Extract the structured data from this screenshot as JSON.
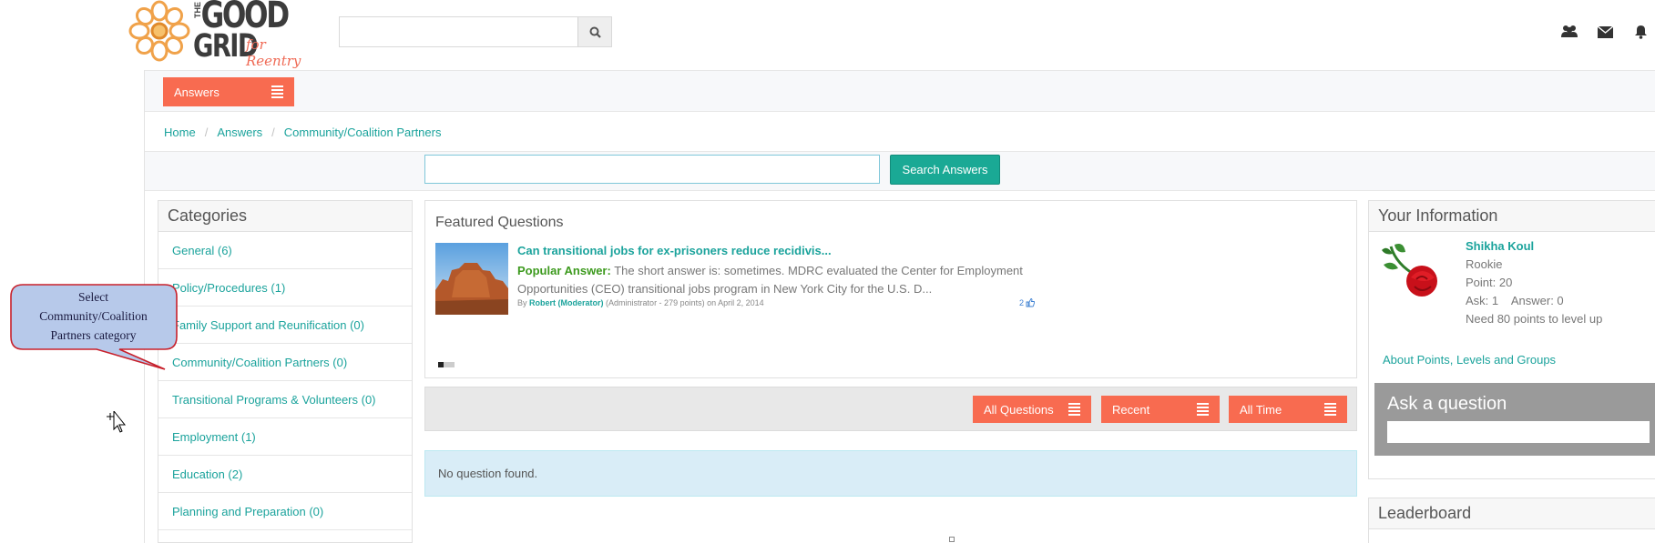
{
  "header": {
    "logo": {
      "the": "THE",
      "good": "GOOD",
      "grid": "GRID",
      "tagline": "for Reentry"
    },
    "search_placeholder": "",
    "icons": [
      "search-icon",
      "users-icon",
      "envelope-icon",
      "bell-icon"
    ]
  },
  "answers_menu": {
    "label": "Answers"
  },
  "breadcrumb": [
    "Home",
    "Answers",
    "Community/Coalition Partners"
  ],
  "answer_search": {
    "value": "",
    "button_label": "Search Answers"
  },
  "categories": {
    "title": "Categories",
    "items": [
      "General (6)",
      "Policy/Procedures (1)",
      "Family Support and Reunification (0)",
      "Community/Coalition Partners (0)",
      "Transitional Programs & Volunteers (0)",
      "Employment (1)",
      "Education (2)",
      "Planning and Preparation (0)"
    ]
  },
  "featured": {
    "title": "Featured Questions",
    "question": "Can transitional jobs for ex-prisoners reduce recidivis...",
    "answer_label": "Popular Answer:",
    "answer_text": "The short answer is: sometimes. MDRC evaluated the Center for Employment Opportunities (CEO) transitional jobs program in New York City for the U.S. D...",
    "by": "By",
    "author": "Robert (Moderator)",
    "author_role": "(Administrator - 279 points)",
    "date": "on April 2, 2014",
    "likes": "2"
  },
  "filters": {
    "all_questions": "All Questions",
    "recent": "Recent",
    "all_time": "All Time"
  },
  "no_results": "No question found.",
  "your_info": {
    "title": "Your Information",
    "name": "Shikha Koul",
    "rank": "Rookie",
    "points": "Point: 20",
    "ask_answer": "Ask: 1    Answer: 0",
    "level_up": "Need 80 points to level up",
    "about_link": "About Points, Levels and Groups"
  },
  "ask_question": {
    "title": "Ask a question",
    "value": ""
  },
  "leaderboard": {
    "title": "Leaderboard"
  },
  "callout": {
    "line1": "Select",
    "line2": "Community/Coalition",
    "line3": "Partners category"
  },
  "colors": {
    "accent": "#1ba39c",
    "orange": "#f86b50",
    "search_button": "#1aa995",
    "info_bg": "#d9edf7",
    "callout_fill": "#b7c9ea",
    "callout_border": "#c8202b"
  }
}
